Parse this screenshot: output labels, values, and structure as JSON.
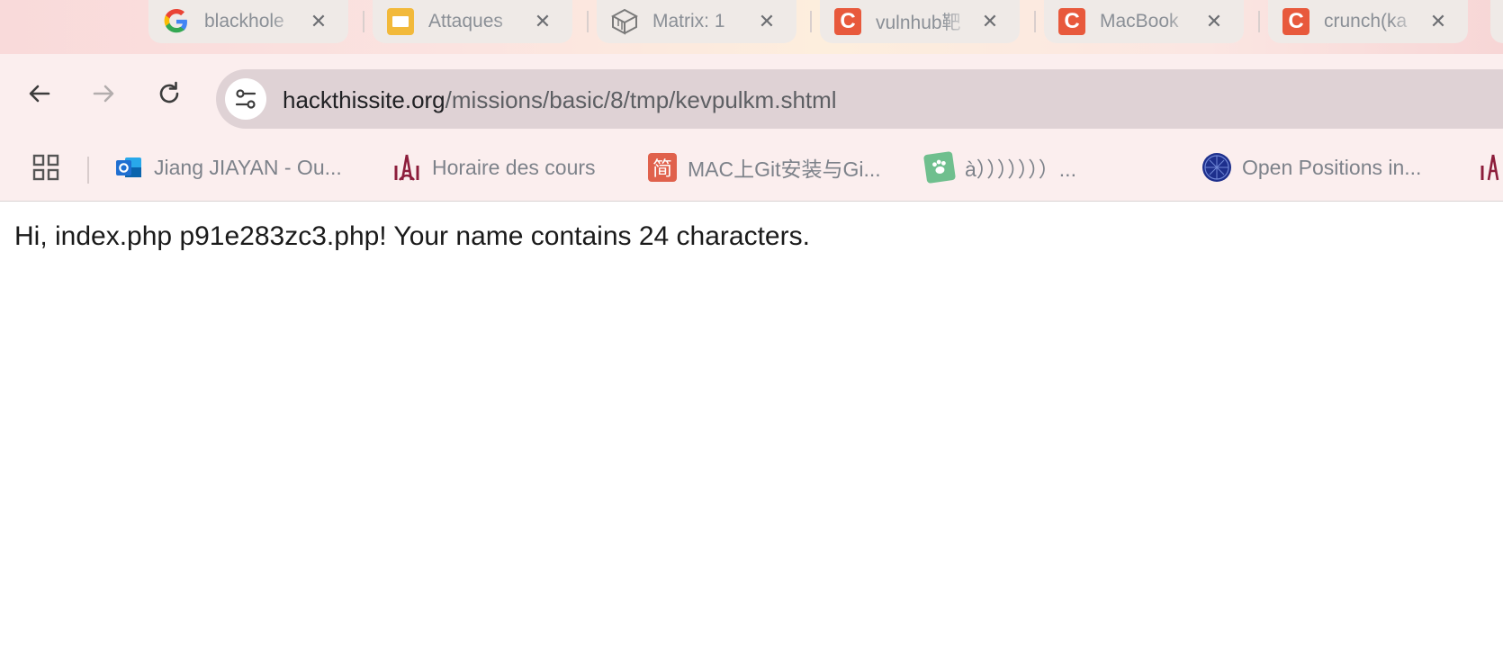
{
  "tabs": [
    {
      "title": "blackhole",
      "favicon": "google-g-icon"
    },
    {
      "title": "Attaques",
      "favicon": "slides-icon"
    },
    {
      "title": "Matrix: 1",
      "favicon": "matrix-cube-icon"
    },
    {
      "title": "vulnhub靶",
      "favicon": "csdn-c-icon"
    },
    {
      "title": "MacBook",
      "favicon": "csdn-c-icon"
    },
    {
      "title": "crunch(ka",
      "favicon": "csdn-c-icon"
    }
  ],
  "tab_close_glyph": "✕",
  "address_bar": {
    "host": "hackthissite.org",
    "path": "/missions/basic/8/tmp/kevpulkm.shtml"
  },
  "bookmarks": [
    {
      "label": "Jiang JIAYAN - Ou...",
      "icon": "outlook-icon"
    },
    {
      "label": "Horaire des cours",
      "icon": "eiffel-tower-icon"
    },
    {
      "label": "MAC上Git安装与Gi...",
      "icon": "jianshu-icon",
      "icon_text": "简"
    },
    {
      "label": "à）））））））...",
      "icon": "paw-icon"
    },
    {
      "label": "Open Positions in...",
      "icon": "globe-icon"
    }
  ],
  "page": {
    "message": "Hi, index.php p91e283zc3.php! Your name contains 24 characters."
  },
  "colors": {
    "csdn": "#e8593c",
    "slides": "#f2b93a",
    "outlook": "#1f6fd1",
    "tab_bg": "#efeae7",
    "toolbar_bg": "#fbeeee"
  }
}
